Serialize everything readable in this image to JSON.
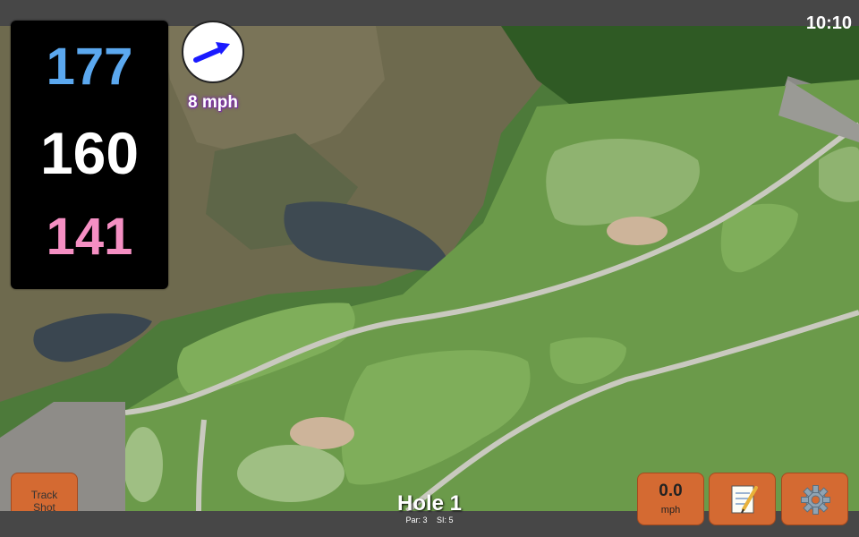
{
  "status": {
    "time": "10:10"
  },
  "yardages": {
    "back": "177",
    "middle": "160",
    "front": "141"
  },
  "wind": {
    "speed": "8 mph",
    "icon": "wind-direction-arrow-icon"
  },
  "hole": {
    "title": "Hole 1",
    "par": "Par: 3",
    "stroke_index": "SI: 5"
  },
  "buttons": {
    "track_shot_line1": "Track",
    "track_shot_line2": "Shot",
    "speed_value": "0.0",
    "speed_unit": "mph",
    "notes_icon": "notepad-icon",
    "settings_icon": "gear-icon"
  },
  "colors": {
    "back_yardage": "#5ba8ef",
    "middle_yardage": "#ffffff",
    "front_yardage": "#f58fc3",
    "button": "#d46a32",
    "wind_arrow": "#1a1aff"
  }
}
